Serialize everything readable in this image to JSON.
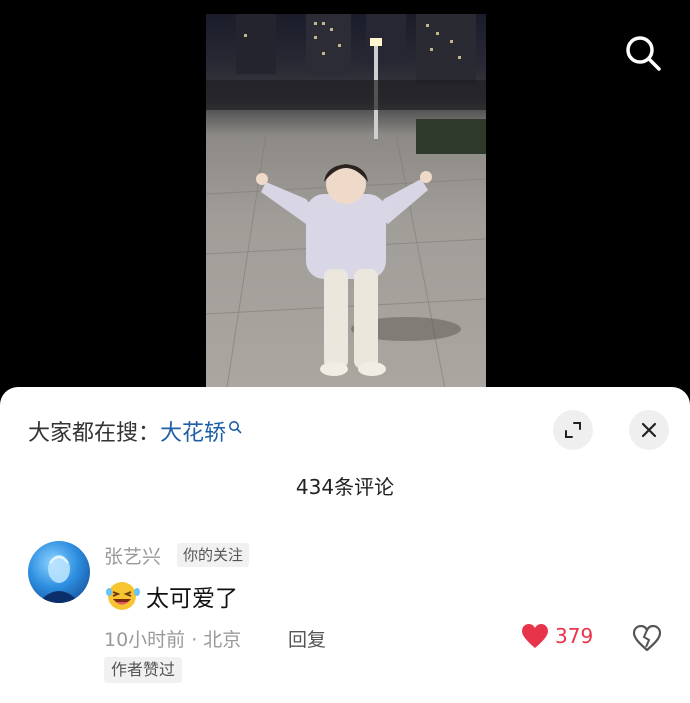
{
  "video": {
    "search_icon": "search-icon"
  },
  "comments_panel": {
    "trending_prefix": "大家都在搜：",
    "trending_term": "大花轿",
    "expand_icon": "expand-icon",
    "close_icon": "close-icon",
    "comment_count": "434条评论"
  },
  "comment": {
    "username": "张艺兴",
    "follow_tag": "你的关注",
    "text": "太可爱了",
    "emoji": "laughing-face-emoji",
    "time_location": "10小时前 · 北京",
    "reply_label": "回复",
    "like_count": "379",
    "like_color": "#e8344a",
    "author_liked_tag": "作者赞过"
  }
}
